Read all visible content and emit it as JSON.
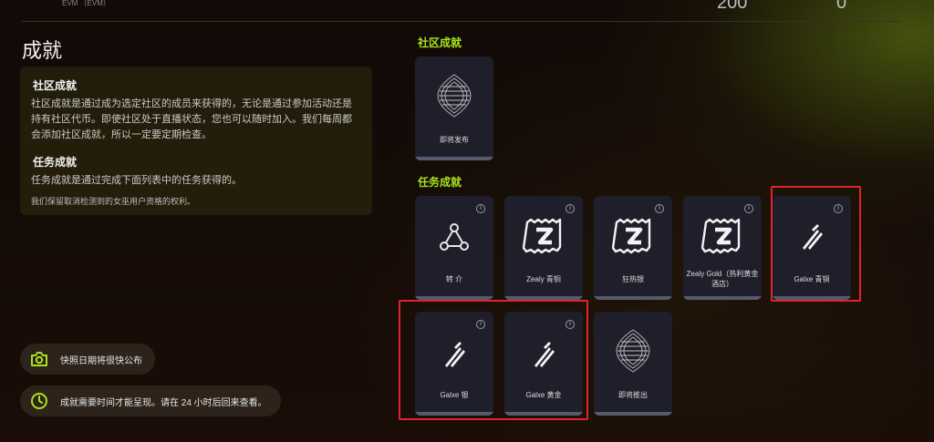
{
  "header": {
    "evm_label": "EVM （EVM）",
    "stat_1": "200",
    "stat_2": "0"
  },
  "page_title": "成就",
  "info": {
    "community_title": "社区成就",
    "community_desc": "社区成就是通过成为选定社区的成员来获得的，无论是通过参加活动还是持有社区代币。即使社区处于直播状态，您也可以随时加入。我们每周都会添加社区成就，所以一定要定期检查。",
    "task_title": "任务成就",
    "task_desc": "任务成就是通过完成下面列表中的任务获得的。",
    "disclaimer": "我们保留取消检测到的女巫用户资格的权利。"
  },
  "notices": {
    "snapshot": "快照日期将很快公布",
    "delay": "成就需要时间才能呈现。请在 24 小时后回来查看。"
  },
  "sections": {
    "community": "社区成就",
    "tasks": "任务成就"
  },
  "community_cards": [
    {
      "label": "即将发布",
      "icon": "orb-icon"
    }
  ],
  "task_cards": [
    {
      "label": "转 介",
      "icon": "referral-icon"
    },
    {
      "label": "Zealy 青铜",
      "icon": "zealy-icon"
    },
    {
      "label": "狂热银",
      "icon": "zealy-icon"
    },
    {
      "label": "Zealy Gold（热利黄金酒店）",
      "icon": "zealy-icon"
    },
    {
      "label": "Galxe 青铜",
      "icon": "galxe-icon"
    },
    {
      "label": "Galxe 银",
      "icon": "galxe-icon"
    },
    {
      "label": "Galxe 黄金",
      "icon": "galxe-icon"
    },
    {
      "label": "即将推出",
      "icon": "orb-icon"
    }
  ],
  "colors": {
    "accent": "#a7e21c",
    "highlight": "#e0242a",
    "card_bg": "#1e1f2b"
  }
}
